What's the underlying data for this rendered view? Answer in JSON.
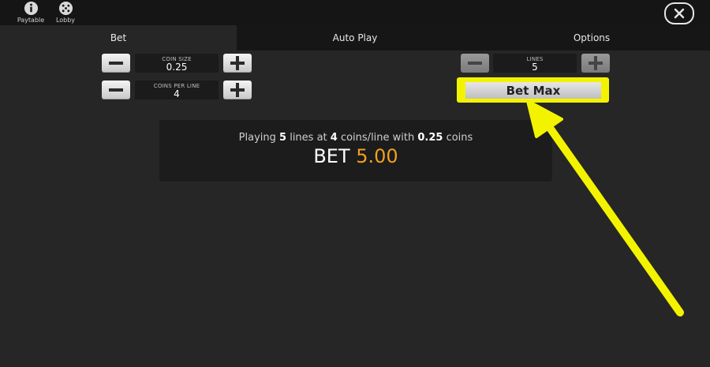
{
  "topbar": {
    "paytable_label": "Paytable",
    "lobby_label": "Lobby",
    "icons": [
      "info-icon",
      "dice-icon",
      "close-icon"
    ]
  },
  "tabs": [
    {
      "label": "Bet",
      "active": true
    },
    {
      "label": "Auto Play",
      "active": false
    },
    {
      "label": "Options",
      "active": false
    }
  ],
  "coin_size": {
    "caption": "COIN SIZE",
    "value": "0.25"
  },
  "coins_per_line": {
    "caption": "COINS PER LINE",
    "value": "4"
  },
  "lines": {
    "caption": "LINES",
    "value": "5"
  },
  "bet_max_label": "Bet Max",
  "summary": {
    "prefix": "Playing ",
    "lines": "5",
    "mid1": " lines at ",
    "coins": "4",
    "mid2": " coins/line with ",
    "coin_size": "0.25",
    "suffix": " coins",
    "bet_label": "BET ",
    "bet_amount": "5.00"
  },
  "colors": {
    "highlight": "#f3f300",
    "bet_amount": "#f0a020",
    "background": "#262626"
  }
}
